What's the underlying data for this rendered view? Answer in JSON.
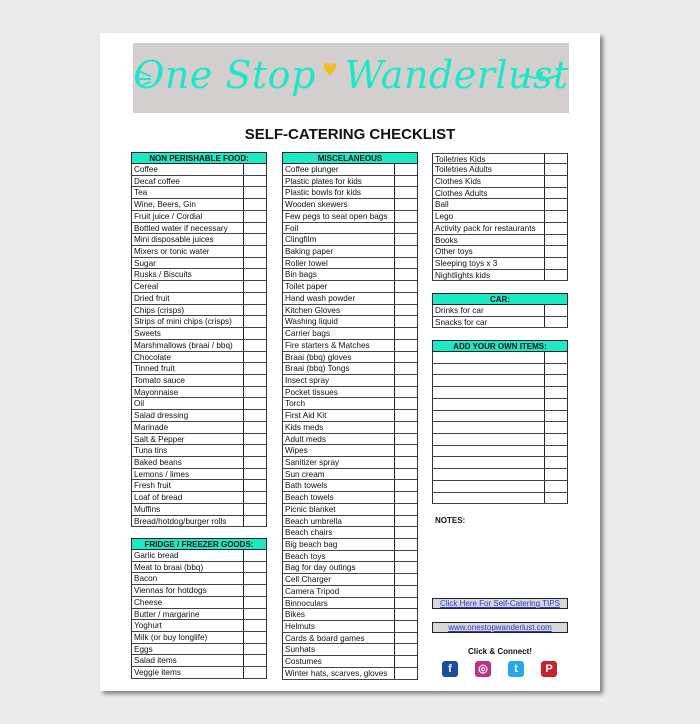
{
  "banner": {
    "title_left": "One Stop",
    "title_right": "Wanderlust",
    "heart": "♥"
  },
  "title": "SELF-CATERING CHECKLIST",
  "sections": {
    "non_perishable": {
      "header": "NON PERISHABLE FOOD:",
      "items": [
        "Coffee",
        "Decaf coffee",
        "Tea",
        "Wine, Beers, Gin",
        "Fruit juice / Cordial",
        "Bottled water if necessary",
        "Mini disposable juices",
        "Mixers or tonic water",
        "Sugar",
        "Rusks / Biscuits",
        "Cereal",
        "Dried fruit",
        "Chips (crisps)",
        "Strips of mini chips (crisps)",
        "Sweets",
        "Marshmallows (braai / bbq)",
        "Chocolate",
        "Tinned fruit",
        "Tomato sauce",
        "Mayonnaise",
        "Oil",
        "Salad dressing",
        "Marinade",
        "Salt & Pepper",
        "Tuna tins",
        "Baked beans",
        "Lemons / limes",
        "Fresh fruit",
        "Loaf of bread",
        "Muffins",
        "Bread/hotdog/burger rolls"
      ]
    },
    "fridge": {
      "header": "FRIDGE / FREEZER GOODS:",
      "items": [
        "Garlic bread",
        "Meat to braai (bbq)",
        "Bacon",
        "Viennas for hotdogs",
        "Cheese",
        "Butter / margarine",
        "Yoghurt",
        "Milk (or buy longlife)",
        "Eggs",
        "Salad items",
        "Veggie items"
      ]
    },
    "misc": {
      "header": "MISCELANEOUS",
      "items": [
        "Coffee plunger",
        "Plastic plates for kids",
        "Plastic bowls for kids",
        "Wooden skewers",
        "Few pegs to seal open bags",
        "Foil",
        "Clingfilm",
        "Baking paper",
        "Roller towel",
        "Bin  bags",
        "Toilet paper",
        "Hand wash powder",
        "Kitchen Gloves",
        "Washing liquid",
        "Carrier bags",
        "Fire starters & Matches",
        "Braai (bbq) gloves",
        "Braai (bbq) Tongs",
        "Insect spray",
        "Pocket tissues",
        "Torch",
        "First Aid Kit",
        "Kids meds",
        "Adult meds",
        "Wipes",
        "Sanitizer spray",
        "Sun cream",
        "Bath towels",
        "Beach towels",
        "Picnic blanket",
        "Beach umbrella",
        "Beach chairs",
        "Big beach bag",
        "Beach toys",
        "Bag for day outings",
        "Cell Charger",
        "Camera Tripod",
        "Binnoculars",
        "Bikes",
        "Helmuts",
        "Cards & board games",
        "Sunhats",
        "Costumes",
        "Winter hats, scarves, gloves"
      ]
    },
    "kids": {
      "items": [
        "Toiletries Kids",
        "Toiletries Adults",
        "Clothes Kids",
        "Clothes Adults",
        "Ball",
        "Lego",
        "Activity pack for restaurants",
        "Books",
        "Other toys",
        "Sleeping toys x 3",
        "Nightlights kids"
      ]
    },
    "car": {
      "header": "CAR:",
      "items": [
        "Drinks for car",
        "Snacks for car"
      ]
    },
    "own": {
      "header": "ADD YOUR OWN ITEMS:",
      "items": [
        "",
        "",
        "",
        "",
        "",
        "",
        "",
        "",
        "",
        "",
        "",
        "",
        ""
      ]
    }
  },
  "notes_label": "NOTES:",
  "links": {
    "tips": "Click Here For Self-Catering TIPS",
    "website": "www.onestopwanderlust.com"
  },
  "connect_label": "Click & Connect!",
  "social": [
    {
      "name": "facebook",
      "glyph": "f",
      "color": "#1b4f9c"
    },
    {
      "name": "instagram",
      "glyph": "◎",
      "color": "#c2337f"
    },
    {
      "name": "twitter",
      "glyph": "t",
      "color": "#29a8e8"
    },
    {
      "name": "pinterest",
      "glyph": "P",
      "color": "#cc1f2c"
    }
  ]
}
